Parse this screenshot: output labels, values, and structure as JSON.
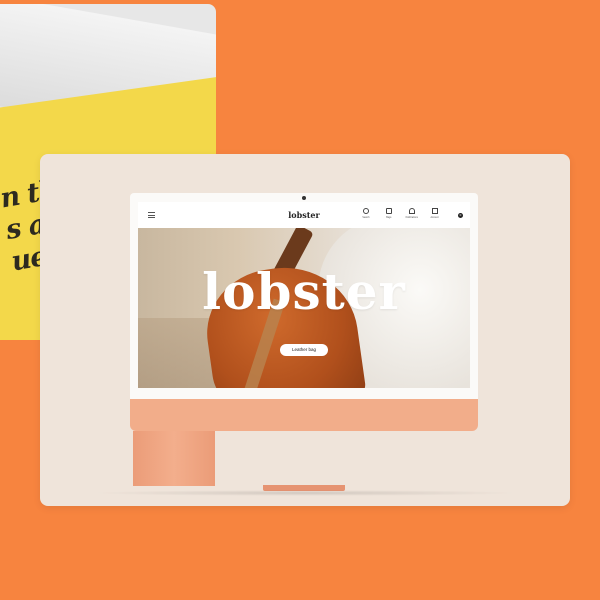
{
  "magazine": {
    "text_lines": "n th\ns a g\nues"
  },
  "site": {
    "logo": "lobster",
    "nav": [
      {
        "label": "Search",
        "icon": "search-icon"
      },
      {
        "label": "Bags",
        "icon": "bag-icon"
      },
      {
        "label": "Notifications",
        "icon": "bell-icon"
      },
      {
        "label": "Account",
        "icon": "account-icon"
      }
    ],
    "cart_count": "0"
  },
  "hero": {
    "title": "lobster",
    "cta_label": "Leather bag"
  },
  "colors": {
    "background": "#f7843f",
    "card": "#efe4da",
    "monitor_chin": "#f2ad8a",
    "magazine_yellow": "#f3d84a"
  }
}
